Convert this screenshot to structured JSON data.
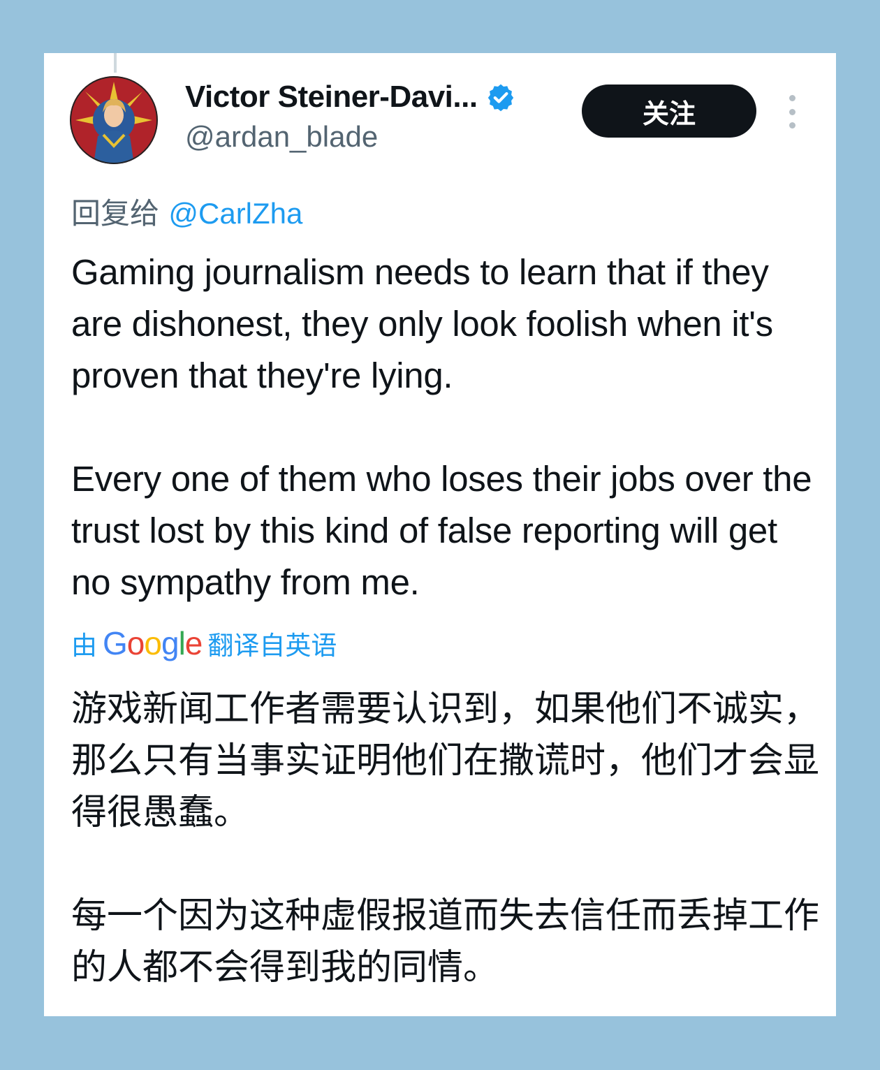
{
  "author": {
    "display_name": "Victor Steiner-Davi...",
    "handle": "@ardan_blade",
    "verified": true
  },
  "follow_button_label": "关注",
  "more_icon": "more-vertical-icon",
  "reply_to": {
    "prefix": "回复给",
    "mention": "@CarlZha"
  },
  "tweet": {
    "paragraphs": [
      "Gaming journalism needs to learn that if they are dishonest, they only look foolish when it's proven that they're lying.",
      "Every one of them who loses their jobs over the trust lost by this kind of false reporting will get no sympathy from me."
    ]
  },
  "translation_credit": {
    "prefix": "由",
    "brand": "Google",
    "suffix": "翻译自英语"
  },
  "translation": {
    "paragraphs": [
      "游戏新闻工作者需要认识到，如果他们不诚实，那么只有当事实证明他们在撒谎时，他们才会显得很愚蠢。",
      "每一个因为这种虚假报道而失去信任而丢掉工作的人都不会得到我的同情。"
    ]
  },
  "colors": {
    "page_background": "#97c2dc",
    "card_background": "#ffffff",
    "text_primary": "#0f1419",
    "text_secondary": "#536471",
    "link": "#1d9bf0",
    "button_background": "#0f1419"
  }
}
